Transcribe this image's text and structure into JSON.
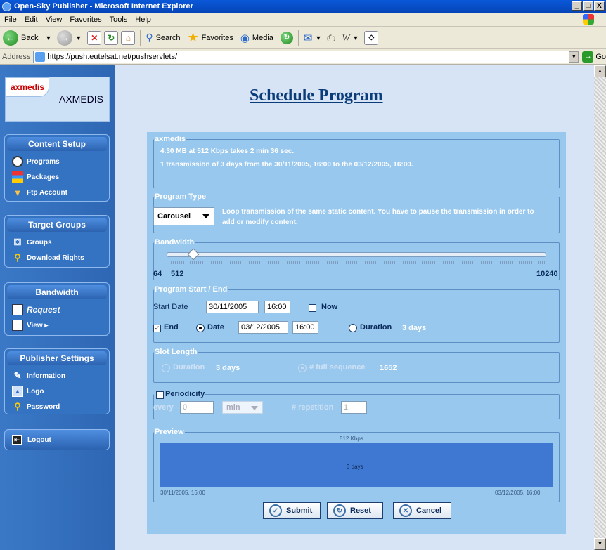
{
  "window": {
    "title": "Open-Sky Publisher - Microsoft Internet Explorer",
    "minimize": "_",
    "maximize": "□",
    "close": "X"
  },
  "menu": [
    "File",
    "Edit",
    "View",
    "Favorites",
    "Tools",
    "Help"
  ],
  "toolbar": {
    "back": "Back",
    "search": "Search",
    "favorites": "Favorites",
    "media": "Media"
  },
  "address": {
    "label": "Address",
    "url": "https://push.eutelsat.net/pushservlets/",
    "go": "Go"
  },
  "sidebar": {
    "logo_badge": "axmedis",
    "logo_text": "AXMEDIS",
    "content_setup": {
      "title": "Content Setup",
      "items": [
        "Programs",
        "Packages",
        "Ftp Account"
      ]
    },
    "target_groups": {
      "title": "Target Groups",
      "items": [
        "Groups",
        "Download Rights"
      ]
    },
    "bandwidth": {
      "title": "Bandwidth",
      "items": [
        "Request",
        "View ▸"
      ]
    },
    "publisher_settings": {
      "title": "Publisher Settings",
      "items": [
        "Information",
        "Logo",
        "Password"
      ]
    },
    "logout": "Logout"
  },
  "main": {
    "title": "Schedule Program",
    "summary": {
      "legend": "axmedis",
      "line1": "4.30 MB at 512 Kbps takes 2 min 36 sec.",
      "line2": "1 transmission of 3 days from the 30/11/2005, 16:00 to the 03/12/2005, 16:00."
    },
    "program_type": {
      "legend": "Program Type",
      "selected": "Carousel",
      "description": "Loop transmission of the same static content. You have to pause the transmission in order to add or modify content."
    },
    "bandwidth": {
      "legend": "Bandwidth",
      "min_label": "64",
      "value_label": "512",
      "max_label": "10240",
      "min": 64,
      "max": 10240,
      "value": 512
    },
    "start_end": {
      "legend": "Program Start / End",
      "start_label": "Start Date",
      "start_date": "30/11/2005",
      "start_time": "16:00",
      "now_label": "Now",
      "now_checked": false,
      "end_label": "End",
      "end_checked": true,
      "date_label": "Date",
      "end_date": "03/12/2005",
      "end_time": "16:00",
      "duration_label": "Duration",
      "duration_value": "3 days"
    },
    "slot_length": {
      "legend": "Slot Length",
      "duration_label": "Duration",
      "duration_value": "3 days",
      "full_seq_label": "# full sequence",
      "full_seq_value": "1652"
    },
    "periodicity": {
      "legend": "Periodicity",
      "checked": false,
      "every_label": "every",
      "every_value": "0",
      "unit": "min",
      "repetition_label": "# repetition",
      "repetition_value": "1"
    },
    "preview": {
      "legend": "Preview",
      "rate": "512 Kbps",
      "duration": "3 days",
      "start": "30/11/2005, 16:00",
      "end": "03/12/2005, 16:00"
    },
    "buttons": {
      "submit": "Submit",
      "reset": "Reset",
      "cancel": "Cancel"
    }
  },
  "colors": {
    "sidebar": "#2e67b4",
    "form_bg": "#98c8ee",
    "page_bg": "#d6e4f5",
    "preview_bar": "#3f78d2",
    "title": "#0b3c7a"
  }
}
